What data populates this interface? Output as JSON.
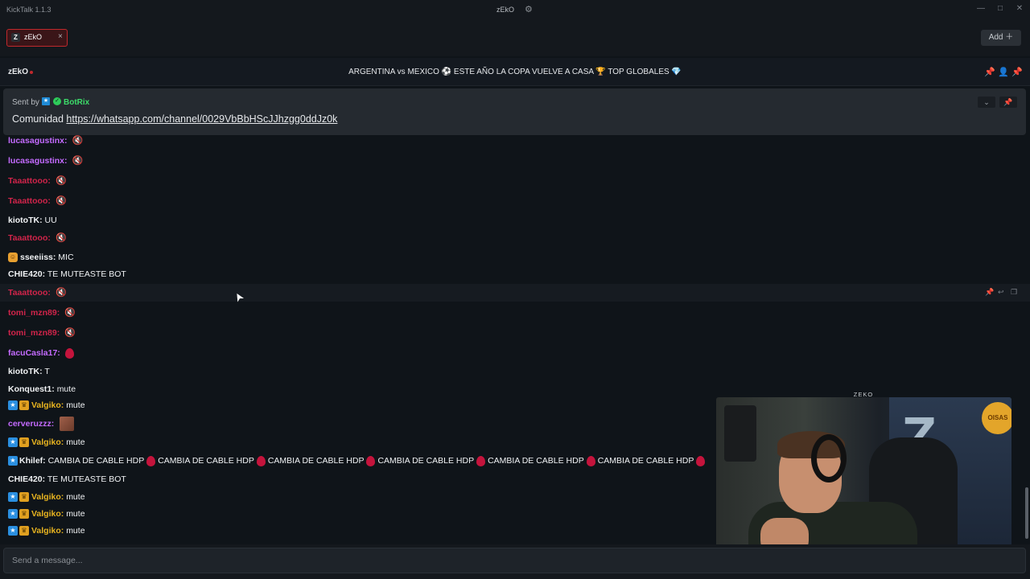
{
  "window": {
    "app_title": "KickTalk 1.1.3",
    "center_title": "zEkO",
    "controls": [
      "—",
      "□",
      "✕"
    ]
  },
  "tabs": [
    {
      "label": "zEkO",
      "logo": "Z",
      "close": "×"
    }
  ],
  "add_button": "Add ＋",
  "channel": {
    "name": "zEkO",
    "stream_title": "ARGENTINA vs MEXICO ⚽ ESTE AÑO LA COPA VUELVE A CASA 🏆 TOP GLOBALES 💎"
  },
  "pinned": {
    "sent_by_label": "Sent by",
    "bot_name": "BotRix",
    "text_prefix": "Comunidad",
    "link": "https://whatsapp.com/channel/0029VbBbHScJJhzgg0ddJz0k"
  },
  "colors": {
    "accent_red": "#c0282c",
    "bot_green": "#3ddc6a",
    "purple": "#c46bff",
    "red_user": "#d0244a",
    "gold": "#e8b420",
    "white": "#f0f2f4"
  },
  "messages": [
    {
      "user": "lucasagustinx",
      "color": "#c46bff",
      "text": "",
      "emote": "mute"
    },
    {
      "user": "lucasagustinx",
      "color": "#c46bff",
      "text": "",
      "emote": "mute"
    },
    {
      "user": "Taaattooo",
      "color": "#d0244a",
      "text": "",
      "emote": "mute"
    },
    {
      "user": "Taaattooo",
      "color": "#d0244a",
      "text": "",
      "emote": "mute"
    },
    {
      "user": "kiotoTK",
      "color": "#f0f2f4",
      "text": "UU"
    },
    {
      "user": "Taaattooo",
      "color": "#d0244a",
      "text": "",
      "emote": "mute"
    },
    {
      "user": "sseeiiss",
      "color": "#f0f2f4",
      "text": "MIC",
      "badge": "face"
    },
    {
      "user": "CHIE420",
      "color": "#f0f2f4",
      "text": "TE MUTEASTE BOT"
    },
    {
      "user": "Taaattooo",
      "color": "#d0244a",
      "text": "",
      "emote": "mute"
    },
    {
      "user": "tomi_mzn89",
      "color": "#d0244a",
      "text": "",
      "emote": "mute"
    },
    {
      "user": "tomi_mzn89",
      "color": "#d0244a",
      "text": "",
      "emote": "mute"
    },
    {
      "user": "facuCasla17",
      "color": "#c46bff",
      "text": "",
      "emote": "drop"
    },
    {
      "user": "kiotoTK",
      "color": "#f0f2f4",
      "text": "T"
    },
    {
      "user": "Konquest1",
      "color": "#f0f2f4",
      "text": "mute"
    },
    {
      "user": "Valgiko",
      "color": "#e8b420",
      "text": "mute",
      "badge": "bluegold"
    },
    {
      "user": "cerveruzzz",
      "color": "#c46bff",
      "text": "",
      "emote": "img"
    },
    {
      "user": "Valgiko",
      "color": "#e8b420",
      "text": "mute",
      "badge": "bluegold"
    },
    {
      "user": "Khilef",
      "color": "#f0f2f4",
      "text": "CAMBIA DE CABLE HDP",
      "badge": "blue",
      "repeat": 6
    },
    {
      "user": "CHIE420",
      "color": "#f0f2f4",
      "text": "TE MUTEASTE BOT"
    },
    {
      "user": "Valgiko",
      "color": "#e8b420",
      "text": "mute",
      "badge": "bluegold"
    },
    {
      "user": "Valgiko",
      "color": "#e8b420",
      "text": "mute",
      "badge": "bluegold"
    },
    {
      "user": "Valgiko",
      "color": "#e8b420",
      "text": "mute",
      "badge": "bluegold"
    }
  ],
  "input": {
    "placeholder": "Send a message..."
  },
  "overlay": {
    "label": "ZEKO",
    "wall_logo": "Z",
    "sign": "OISAS",
    "bottom_logo": "Z"
  },
  "icons": {
    "gear": "⚙",
    "pin": "📌",
    "user": "👤",
    "reply": "↩",
    "copy": "❐",
    "chevron": "⌄",
    "cursor": "➤"
  }
}
